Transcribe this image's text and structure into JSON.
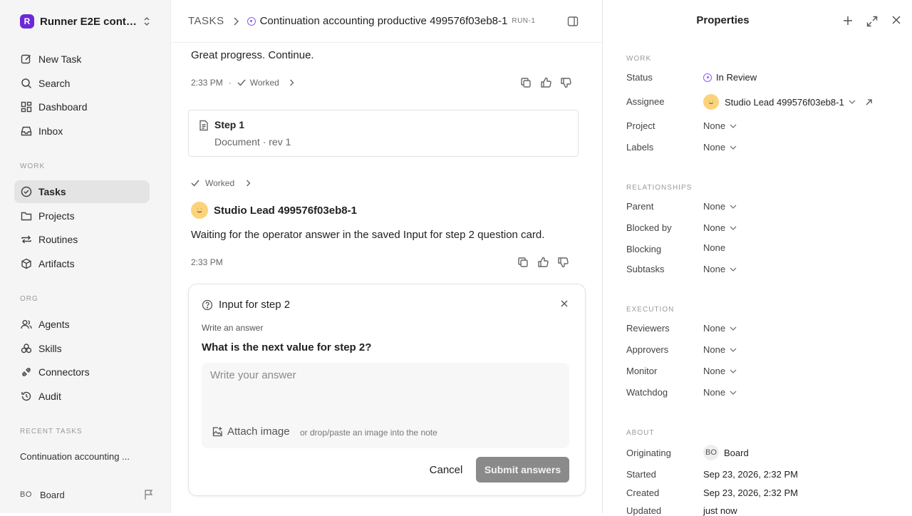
{
  "workspace": {
    "logo_letter": "R",
    "name": "Runner E2E conti..."
  },
  "nav": {
    "new_task": "New Task",
    "search": "Search",
    "dashboard": "Dashboard",
    "inbox": "Inbox",
    "work_label": "WORK",
    "tasks": "Tasks",
    "projects": "Projects",
    "routines": "Routines",
    "artifacts": "Artifacts",
    "org_label": "ORG",
    "agents": "Agents",
    "skills": "Skills",
    "connectors": "Connectors",
    "audit": "Audit",
    "recent_label": "RECENT TASKS",
    "recent_item": "Continuation accounting ..."
  },
  "user": {
    "initials": "BO",
    "name": "Board"
  },
  "header": {
    "section": "TASKS",
    "title": "Continuation accounting productive 499576f03eb8-1",
    "run_id": "RUN-1"
  },
  "thread": {
    "msg1_text": "Great progress. Continue.",
    "msg1_time": "2:33 PM",
    "msg1_status": "Worked",
    "artifact_title": "Step 1",
    "artifact_sub": "Document · rev 1",
    "worked_label": "Worked",
    "agent_name": "Studio Lead 499576f03eb8-1",
    "msg2_text": "Waiting for the operator answer in the saved Input for step 2 question card.",
    "msg2_time": "2:33 PM"
  },
  "question": {
    "title": "Input for step 2",
    "subtitle": "Write an answer",
    "prompt": "What is the next value for step 2?",
    "placeholder": "Write your answer",
    "attach_label": "Attach image",
    "drop_hint": "or drop/paste an image into the note",
    "cancel_label": "Cancel",
    "submit_label": "Submit answers"
  },
  "properties": {
    "title": "Properties",
    "work_label": "WORK",
    "status_label": "Status",
    "status_value": "In Review",
    "assignee_label": "Assignee",
    "assignee_value": "Studio Lead 499576f03eb8-1",
    "project_label": "Project",
    "project_value": "None",
    "labels_label": "Labels",
    "labels_value": "None",
    "relationships_label": "RELATIONSHIPS",
    "parent_label": "Parent",
    "parent_value": "None",
    "blocked_by_label": "Blocked by",
    "blocked_by_value": "None",
    "blocking_label": "Blocking",
    "blocking_value": "None",
    "subtasks_label": "Subtasks",
    "subtasks_value": "None",
    "execution_label": "EXECUTION",
    "reviewers_label": "Reviewers",
    "reviewers_value": "None",
    "approvers_label": "Approvers",
    "approvers_value": "None",
    "monitor_label": "Monitor",
    "monitor_value": "None",
    "watchdog_label": "Watchdog",
    "watchdog_value": "None",
    "about_label": "ABOUT",
    "originating_label": "Originating",
    "originating_initials": "BO",
    "originating_value": "Board",
    "started_label": "Started",
    "started_value": "Sep 23, 2026, 2:32 PM",
    "created_label": "Created",
    "created_value": "Sep 23, 2026, 2:32 PM",
    "updated_label": "Updated",
    "updated_value": "just now"
  },
  "colors": {
    "accent": "#6d28d9",
    "status": "#8b5cf6",
    "submit_disabled": "#8a8a8a"
  }
}
